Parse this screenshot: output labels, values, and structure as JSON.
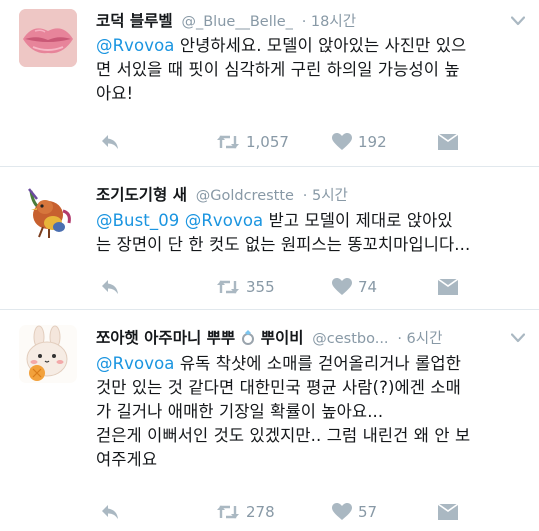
{
  "colors": {
    "link": "#1b95e0",
    "meta": "#8899a6",
    "icon": "#aab8c2",
    "divider": "#e1e8ed"
  },
  "tweets": [
    {
      "avatar": "lips-photo",
      "name": "코덕 블루벨",
      "handle": "@_Blue__Belle_",
      "time": "· 18시간",
      "lines": [
        {
          "mention": "@Rvovoa",
          "text": " 안녕하세요. 모델이 앉아있는 사진만 있으"
        },
        {
          "text": "면 서있을 때 핏이 심각하게 구린 하의일 가능성이 높"
        },
        {
          "text": "아요!"
        }
      ],
      "retweets": "1,057",
      "likes": "192"
    },
    {
      "avatar": "bird-illustration",
      "name": "조기도기형 새",
      "handle": "@Goldcrestte",
      "time": "· 5시간",
      "lines": [
        {
          "mention": "@Bust_09 @Rvovoa",
          "text": "  받고 모델이 제대로 앉아있"
        },
        {
          "text": "는 장면이 단 한 컷도 없는 원피스는 똥꼬치마입니다..."
        }
      ],
      "retweets": "355",
      "likes": "74"
    },
    {
      "avatar": "bunny-illustration",
      "name": "쪼아햇 아주마니 뿌뿌",
      "name_suffix": "뿌이비",
      "handle": "@cestbo...",
      "time": "· 6시간",
      "lines": [
        {
          "mention": "@Rvovoa",
          "text": " 유독 착샷에 소매를 걷어올리거나 롤업한"
        },
        {
          "text": "것만 있는 것 같다면 대한민국 평균 사람(?)에겐 소매"
        },
        {
          "text": "가 길거나 애매한 기장일 확률이 높아요..."
        },
        {
          "text": "걷은게 이뻐서인 것도 있겠지만.. 그럼 내린건 왜 안 보"
        },
        {
          "text": "여주게요"
        }
      ],
      "retweets": "278",
      "likes": "57"
    }
  ]
}
